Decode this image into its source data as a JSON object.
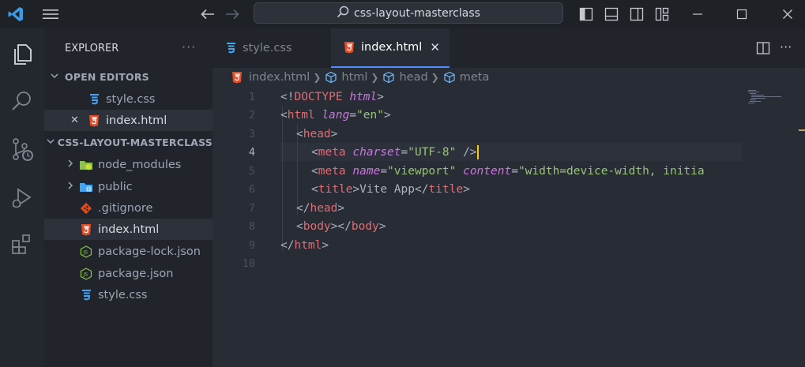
{
  "window": {
    "search_text": "css-layout-masterclass"
  },
  "sidebar": {
    "title": "EXPLORER",
    "more": "···",
    "open_editors_label": "OPEN EDITORS",
    "open_editors": [
      {
        "name": "style.css",
        "icon": "css-icon"
      },
      {
        "name": "index.html",
        "icon": "html-icon",
        "close": "✕"
      }
    ],
    "project_label": "CSS-LAYOUT-MASTERCLASS",
    "files": [
      {
        "name": "node_modules",
        "icon": "folder-node-icon"
      },
      {
        "name": "public",
        "icon": "folder-public-icon"
      },
      {
        "name": ".gitignore",
        "icon": "git-icon"
      },
      {
        "name": "index.html",
        "icon": "html-icon"
      },
      {
        "name": "package-lock.json",
        "icon": "json-icon"
      },
      {
        "name": "package.json",
        "icon": "json-icon"
      },
      {
        "name": "style.css",
        "icon": "css-icon"
      }
    ]
  },
  "tabs": [
    {
      "label": "style.css",
      "active": false
    },
    {
      "label": "index.html",
      "active": true,
      "close": "✕"
    }
  ],
  "breadcrumb": [
    "index.html",
    "html",
    "head",
    "meta"
  ],
  "code": {
    "current_line": 4,
    "line_numbers": [
      "1",
      "2",
      "3",
      "4",
      "5",
      "6",
      "7",
      "8",
      "9",
      "10"
    ]
  },
  "colors": {
    "accent": "#528bff",
    "tag": "#e06c75",
    "attribute": "#c678dd",
    "string": "#98c379",
    "html_icon": "#e44d26",
    "css_icon": "#42a5f5"
  }
}
